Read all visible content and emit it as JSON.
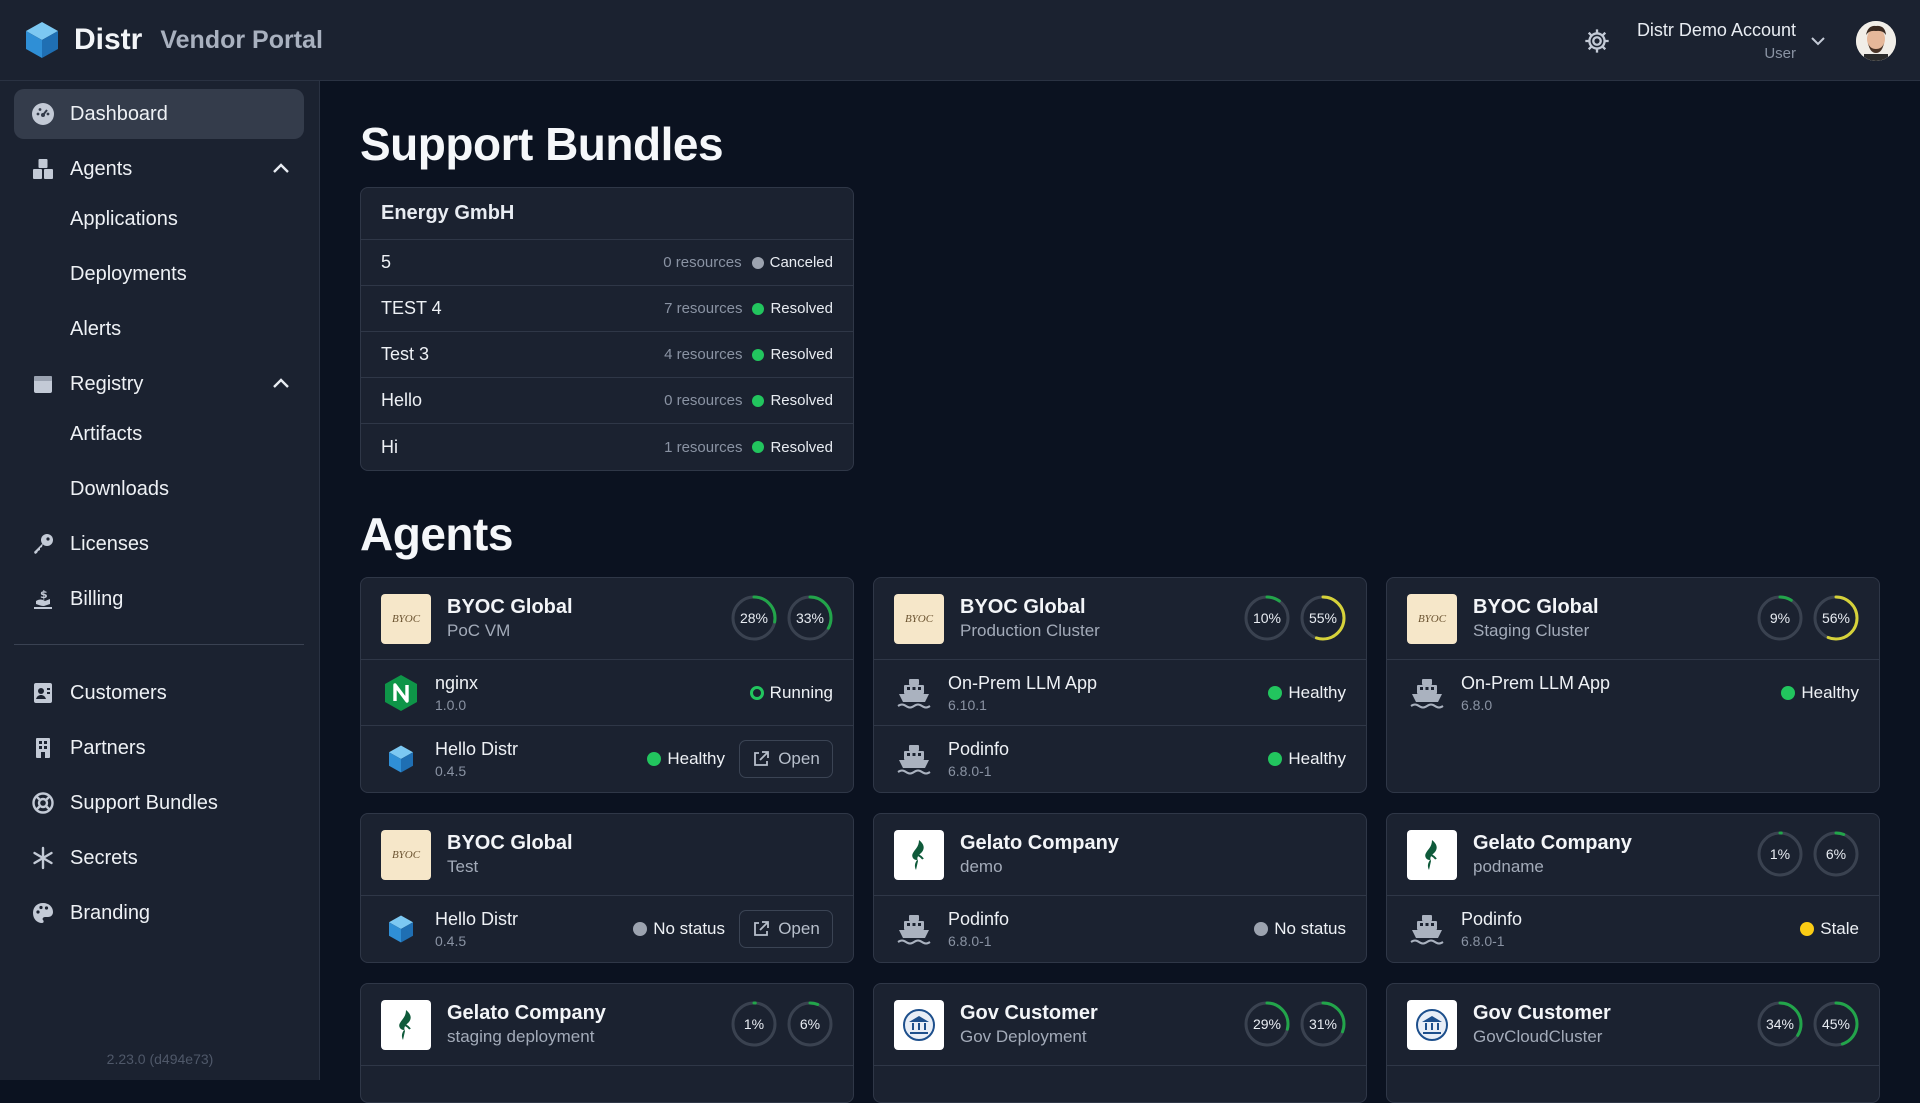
{
  "header": {
    "brand": "Distr",
    "subtitle": "Vendor Portal",
    "account_name": "Distr Demo Account",
    "account_role": "User"
  },
  "sidebar": {
    "items": [
      {
        "label": "Dashboard",
        "icon": "dashboard-icon"
      },
      {
        "label": "Agents",
        "icon": "agents-icon"
      },
      {
        "label": "Applications"
      },
      {
        "label": "Deployments"
      },
      {
        "label": "Alerts"
      },
      {
        "label": "Registry",
        "icon": "registry-icon"
      },
      {
        "label": "Artifacts"
      },
      {
        "label": "Downloads"
      },
      {
        "label": "Licenses",
        "icon": "key-icon"
      },
      {
        "label": "Billing",
        "icon": "billing-icon"
      },
      {
        "label": "Customers",
        "icon": "customers-icon"
      },
      {
        "label": "Partners",
        "icon": "partners-icon"
      },
      {
        "label": "Support Bundles",
        "icon": "support-icon"
      },
      {
        "label": "Secrets",
        "icon": "asterisk-icon"
      },
      {
        "label": "Branding",
        "icon": "palette-icon"
      }
    ],
    "version": "2.23.0 (d494e73)"
  },
  "support_bundles": {
    "heading": "Support Bundles",
    "customer": "Energy GmbH",
    "rows": [
      {
        "name": "5",
        "resources": "0 resources",
        "status": "Canceled",
        "color": "#9ca3af"
      },
      {
        "name": "TEST 4",
        "resources": "7 resources",
        "status": "Resolved",
        "color": "#22c55e"
      },
      {
        "name": "Test 3",
        "resources": "4 resources",
        "status": "Resolved",
        "color": "#22c55e"
      },
      {
        "name": "Hello",
        "resources": "0 resources",
        "status": "Resolved",
        "color": "#22c55e"
      },
      {
        "name": "Hi",
        "resources": "1 resources",
        "status": "Resolved",
        "color": "#22c55e"
      }
    ]
  },
  "agents": {
    "heading": "Agents",
    "open_label": "Open",
    "cards": [
      {
        "title": "BYOC Global",
        "subtitle": "PoC VM",
        "logo": "byoc",
        "gauges": [
          {
            "label": "28%",
            "value": 28
          },
          {
            "label": "33%",
            "value": 33
          }
        ],
        "rows": [
          {
            "name": "nginx",
            "version": "1.0.0",
            "icon": "nginx",
            "status": "Running",
            "dot": "#22c55e",
            "open": false
          },
          {
            "name": "Hello Distr",
            "version": "0.4.5",
            "icon": "cube",
            "status": "Healthy",
            "dot": "#22c55e",
            "open": true
          }
        ]
      },
      {
        "title": "BYOC Global",
        "subtitle": "Production Cluster",
        "logo": "byoc",
        "gauges": [
          {
            "label": "10%",
            "value": 10
          },
          {
            "label": "55%",
            "value": 55
          }
        ],
        "rows": [
          {
            "name": "On-Prem LLM App",
            "version": "6.10.1",
            "icon": "ship",
            "status": "Healthy",
            "dot": "#22c55e",
            "open": false
          },
          {
            "name": "Podinfo",
            "version": "6.8.0-1",
            "icon": "ship",
            "status": "Healthy",
            "dot": "#22c55e",
            "open": false
          }
        ]
      },
      {
        "title": "BYOC Global",
        "subtitle": "Staging Cluster",
        "logo": "byoc",
        "gauges": [
          {
            "label": "9%",
            "value": 9
          },
          {
            "label": "56%",
            "value": 56
          }
        ],
        "rows": [
          {
            "name": "On-Prem LLM App",
            "version": "6.8.0",
            "icon": "ship",
            "status": "Healthy",
            "dot": "#22c55e",
            "open": false
          }
        ]
      },
      {
        "title": "BYOC Global",
        "subtitle": "Test",
        "logo": "byoc",
        "gauges": [],
        "rows": [
          {
            "name": "Hello Distr",
            "version": "0.4.5",
            "icon": "cube",
            "status": "No status",
            "dot": "#9ca3af",
            "open": true
          }
        ]
      },
      {
        "title": "Gelato Company",
        "subtitle": "demo",
        "logo": "gelato",
        "gauges": [],
        "rows": [
          {
            "name": "Podinfo",
            "version": "6.8.0-1",
            "icon": "ship",
            "status": "No status",
            "dot": "#9ca3af",
            "open": false
          }
        ]
      },
      {
        "title": "Gelato Company",
        "subtitle": "podname",
        "logo": "gelato",
        "gauges": [
          {
            "label": "1%",
            "value": 1
          },
          {
            "label": "6%",
            "value": 6
          }
        ],
        "rows": [
          {
            "name": "Podinfo",
            "version": "6.8.0-1",
            "icon": "ship",
            "status": "Stale",
            "dot": "#facc15",
            "open": false
          }
        ]
      },
      {
        "title": "Gelato Company",
        "subtitle": "staging deployment",
        "logo": "gelato",
        "gauges": [
          {
            "label": "1%",
            "value": 1
          },
          {
            "label": "6%",
            "value": 6
          }
        ],
        "rows": []
      },
      {
        "title": "Gov Customer",
        "subtitle": "Gov Deployment",
        "logo": "gov",
        "gauges": [
          {
            "label": "29%",
            "value": 29
          },
          {
            "label": "31%",
            "value": 31
          }
        ],
        "rows": []
      },
      {
        "title": "Gov Customer",
        "subtitle": "GovCloudCluster",
        "logo": "gov",
        "gauges": [
          {
            "label": "34%",
            "value": 34
          },
          {
            "label": "45%",
            "value": 45
          }
        ],
        "rows": []
      }
    ]
  },
  "byoc_logo_text": "BYOC"
}
